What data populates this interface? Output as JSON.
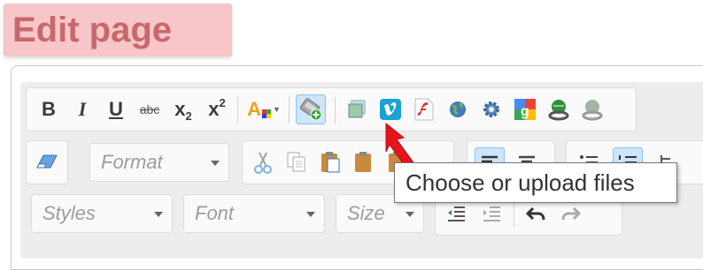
{
  "page": {
    "title": "Edit page"
  },
  "toolbar": {
    "row1": {
      "bold": "B",
      "italic": "I",
      "underline": "U",
      "strike": "abc",
      "subscript_base": "x",
      "subscript_mark": "2",
      "superscript_base": "x",
      "superscript_mark": "2",
      "text_color_glyph": "A"
    },
    "row2": {
      "format_combo": "Format"
    },
    "row3": {
      "styles_combo": "Styles",
      "font_combo": "Font",
      "size_combo": "Size"
    }
  },
  "tooltip": {
    "text": "Choose or upload files"
  },
  "colors": {
    "title_bg": "#f6c6c8",
    "title_text": "#c9676b",
    "active_bg": "#cce6fb",
    "arrow": "#e8141b"
  },
  "icons": [
    "eraser-icon",
    "cut-icon",
    "copy-icon",
    "paste-icon",
    "paste-text-icon",
    "paste-word-icon",
    "align-left-icon",
    "align-center-icon",
    "bullet-list-icon",
    "numbered-list-icon",
    "file-browser-icon",
    "image-icon",
    "vimeo-icon",
    "flash-icon",
    "globe-icon",
    "google-maps-icon",
    "link-icon",
    "anchor-icon",
    "outdent-icon",
    "indent-icon",
    "undo-icon",
    "redo-icon"
  ]
}
